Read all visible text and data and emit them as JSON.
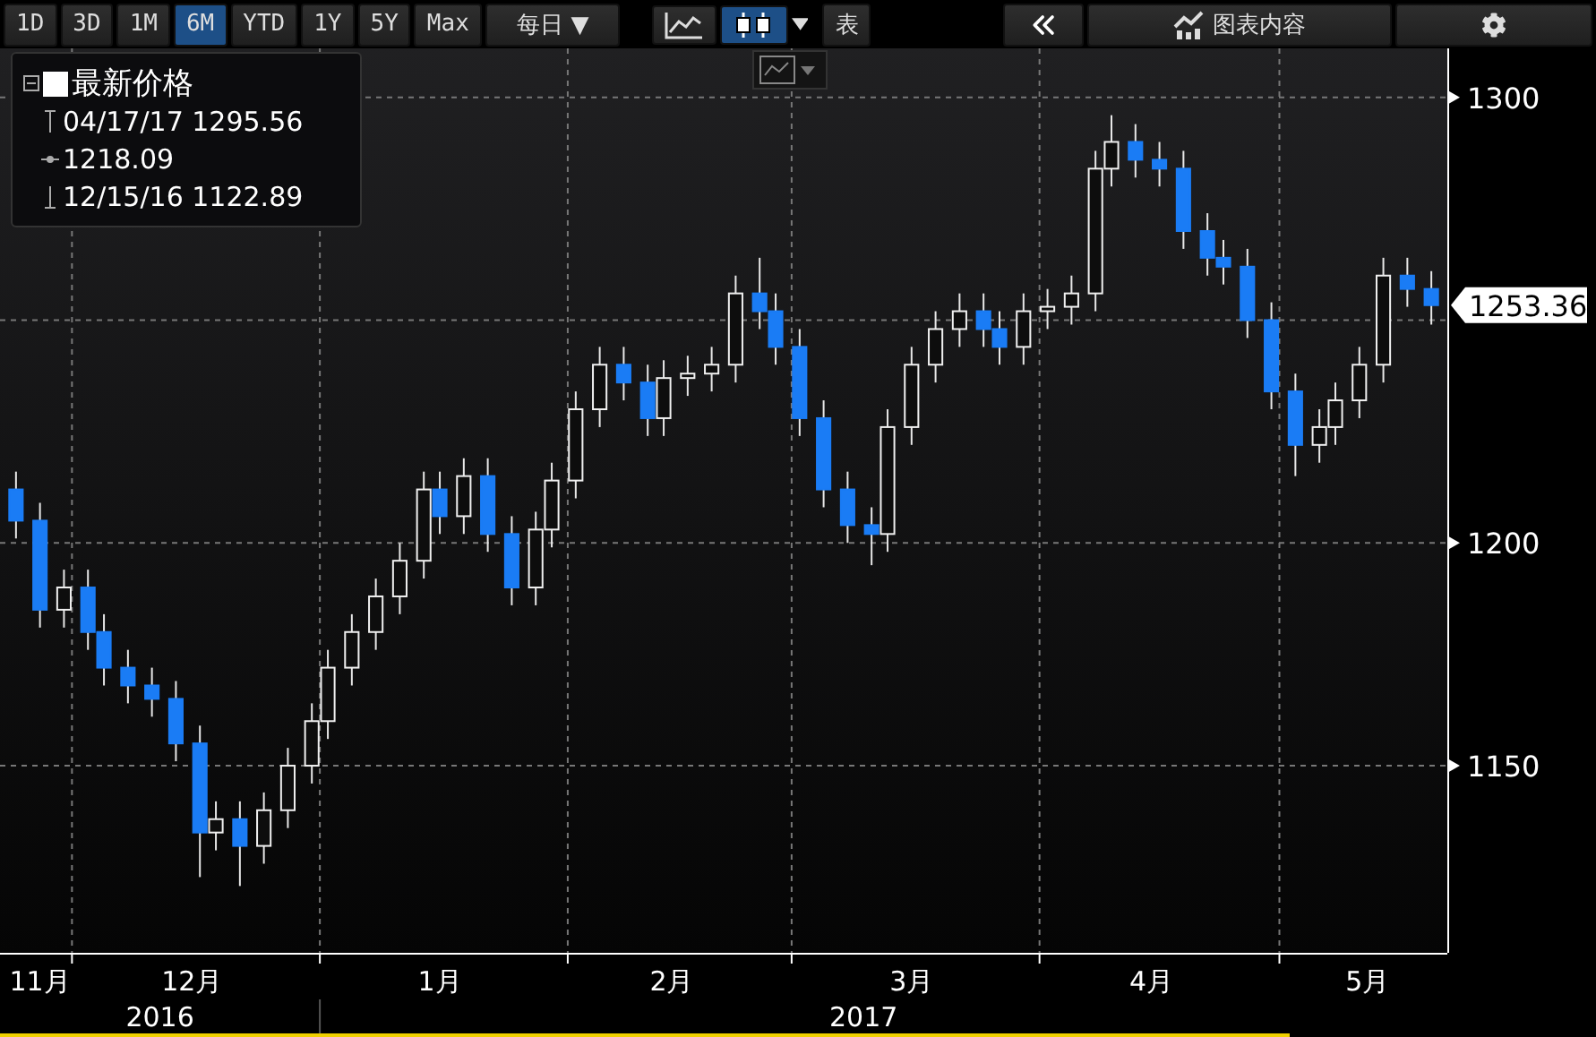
{
  "toolbar": {
    "periods": [
      {
        "label": "1D",
        "selected": false
      },
      {
        "label": "3D",
        "selected": false
      },
      {
        "label": "1M",
        "selected": false
      },
      {
        "label": "6M",
        "selected": true
      },
      {
        "label": "YTD",
        "selected": false
      },
      {
        "label": "1Y",
        "selected": false
      },
      {
        "label": "5Y",
        "selected": false
      },
      {
        "label": "Max",
        "selected": false
      }
    ],
    "frequency": {
      "label": "每日",
      "caret": "▼"
    },
    "chart_types": [
      {
        "kind": "line",
        "selected": false
      },
      {
        "kind": "candle",
        "selected": true
      }
    ],
    "table_button": "表",
    "chart_content_button": "图表内容"
  },
  "legend": {
    "title": "最新价格",
    "high": "04/17/17 1295.56",
    "average": "1218.09",
    "low": "12/15/16 1122.89"
  },
  "last_price": "1253.36",
  "chart_data": {
    "type": "candlestick",
    "ylim": [
      1108,
      1311
    ],
    "xlim": [
      "2016-11-22",
      "2017-05-22"
    ],
    "yticks": [
      1150,
      1200,
      1300
    ],
    "xticks": [
      {
        "value": "2016-11-27",
        "label": "11月"
      },
      {
        "value": "2016-12-16",
        "label": "12月"
      },
      {
        "value": "2017-01-16",
        "label": "1月"
      },
      {
        "value": "2017-02-14",
        "label": "2月"
      },
      {
        "value": "2017-03-16",
        "label": "3月"
      },
      {
        "value": "2017-04-15",
        "label": "4月"
      },
      {
        "value": "2017-05-12",
        "label": "5月"
      }
    ],
    "annotations": [
      "2016",
      "2017"
    ],
    "grid": true,
    "x": [
      "2016-11-24",
      "2016-11-27",
      "2016-11-30",
      "2016-12-03",
      "2016-12-05",
      "2016-12-08",
      "2016-12-11",
      "2016-12-14",
      "2016-12-17",
      "2016-12-19",
      "2016-12-22",
      "2016-12-25",
      "2016-12-28",
      "2016-12-31",
      "2017-01-02",
      "2017-01-05",
      "2017-01-08",
      "2017-01-11",
      "2017-01-14",
      "2017-01-16",
      "2017-01-19",
      "2017-01-22",
      "2017-01-25",
      "2017-01-28",
      "2017-01-30",
      "2017-02-02",
      "2017-02-05",
      "2017-02-08",
      "2017-02-11",
      "2017-02-13",
      "2017-02-16",
      "2017-02-19",
      "2017-02-22",
      "2017-02-25",
      "2017-02-27",
      "2017-03-02",
      "2017-03-05",
      "2017-03-08",
      "2017-03-11",
      "2017-03-13",
      "2017-03-16",
      "2017-03-19",
      "2017-03-22",
      "2017-03-25",
      "2017-03-27",
      "2017-03-30",
      "2017-04-02",
      "2017-04-05",
      "2017-04-08",
      "2017-04-10",
      "2017-04-13",
      "2017-04-16",
      "2017-04-19",
      "2017-04-22",
      "2017-04-24",
      "2017-04-27",
      "2017-04-30",
      "2017-05-03",
      "2017-05-06",
      "2017-05-08",
      "2017-05-11",
      "2017-05-14",
      "2017-05-17",
      "2017-05-20"
    ],
    "ohlc": [
      [
        1212,
        1216,
        1201,
        1205
      ],
      [
        1205,
        1209,
        1181,
        1185
      ],
      [
        1185,
        1194,
        1181,
        1190
      ],
      [
        1190,
        1194,
        1176,
        1180
      ],
      [
        1180,
        1184,
        1168,
        1172
      ],
      [
        1172,
        1176,
        1164,
        1168
      ],
      [
        1168,
        1172,
        1161,
        1165
      ],
      [
        1165,
        1169,
        1151,
        1155
      ],
      [
        1155,
        1159,
        1125,
        1135
      ],
      [
        1135,
        1142,
        1131,
        1138
      ],
      [
        1138,
        1142,
        1123,
        1132
      ],
      [
        1132,
        1144,
        1128,
        1140
      ],
      [
        1140,
        1154,
        1136,
        1150
      ],
      [
        1150,
        1164,
        1146,
        1160
      ],
      [
        1160,
        1176,
        1156,
        1172
      ],
      [
        1172,
        1184,
        1168,
        1180
      ],
      [
        1180,
        1192,
        1176,
        1188
      ],
      [
        1188,
        1200,
        1184,
        1196
      ],
      [
        1196,
        1216,
        1192,
        1212
      ],
      [
        1212,
        1216,
        1202,
        1206
      ],
      [
        1206,
        1219,
        1202,
        1215
      ],
      [
        1215,
        1219,
        1198,
        1202
      ],
      [
        1202,
        1206,
        1186,
        1190
      ],
      [
        1190,
        1207,
        1186,
        1203
      ],
      [
        1203,
        1218,
        1199,
        1214
      ],
      [
        1214,
        1234,
        1210,
        1230
      ],
      [
        1230,
        1244,
        1226,
        1240
      ],
      [
        1240,
        1244,
        1232,
        1236
      ],
      [
        1236,
        1240,
        1224,
        1228
      ],
      [
        1228,
        1241,
        1224,
        1237
      ],
      [
        1237,
        1242,
        1233,
        1238
      ],
      [
        1238,
        1244,
        1234,
        1240
      ],
      [
        1240,
        1260,
        1236,
        1256
      ],
      [
        1256,
        1264,
        1248,
        1252
      ],
      [
        1252,
        1256,
        1240,
        1244
      ],
      [
        1244,
        1248,
        1224,
        1228
      ],
      [
        1228,
        1232,
        1208,
        1212
      ],
      [
        1212,
        1216,
        1200,
        1204
      ],
      [
        1204,
        1208,
        1195,
        1202
      ],
      [
        1202,
        1230,
        1198,
        1226
      ],
      [
        1226,
        1244,
        1222,
        1240
      ],
      [
        1240,
        1252,
        1236,
        1248
      ],
      [
        1248,
        1256,
        1244,
        1252
      ],
      [
        1252,
        1256,
        1244,
        1248
      ],
      [
        1248,
        1252,
        1240,
        1244
      ],
      [
        1244,
        1256,
        1240,
        1252
      ],
      [
        1252,
        1257,
        1248,
        1253
      ],
      [
        1253,
        1260,
        1249,
        1256
      ],
      [
        1256,
        1288,
        1252,
        1284
      ],
      [
        1284,
        1296,
        1280,
        1290
      ],
      [
        1290,
        1294,
        1282,
        1286
      ],
      [
        1286,
        1290,
        1280,
        1284
      ],
      [
        1284,
        1288,
        1266,
        1270
      ],
      [
        1270,
        1274,
        1260,
        1264
      ],
      [
        1264,
        1268,
        1258,
        1262
      ],
      [
        1262,
        1266,
        1246,
        1250
      ],
      [
        1250,
        1254,
        1230,
        1234
      ],
      [
        1234,
        1238,
        1215,
        1222
      ],
      [
        1222,
        1230,
        1218,
        1226
      ],
      [
        1226,
        1236,
        1222,
        1232
      ],
      [
        1232,
        1244,
        1228,
        1240
      ],
      [
        1240,
        1264,
        1236,
        1260
      ],
      [
        1260,
        1264,
        1253,
        1257
      ],
      [
        1257,
        1261,
        1249,
        1253.36
      ]
    ]
  }
}
